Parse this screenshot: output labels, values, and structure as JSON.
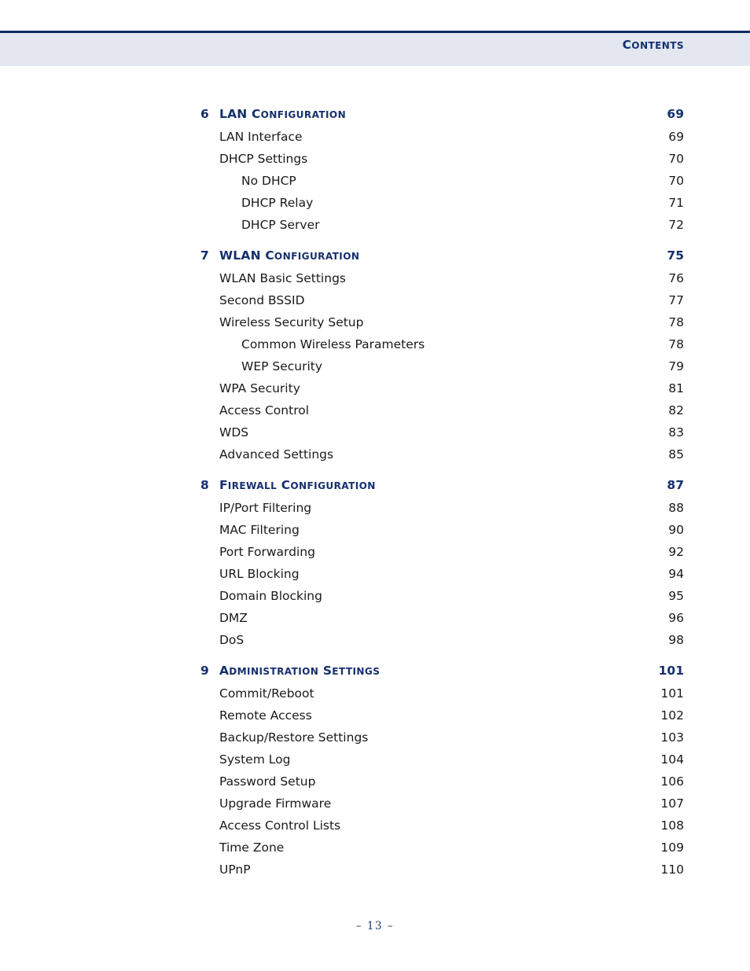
{
  "header": {
    "title_lead": "C",
    "title_rest": "ONTENTS",
    "rule_color": "#0b2a63",
    "band_color": "#e4e7f0",
    "accent_color": "#16306e"
  },
  "footer": {
    "page_marker": "–  13  –"
  },
  "toc": {
    "sections": [
      {
        "number": "6",
        "title_lead": "LAN C",
        "title_rest": "ONFIGURATION",
        "page": "69",
        "entries": [
          {
            "level": 1,
            "label": "LAN Interface",
            "page": "69"
          },
          {
            "level": 1,
            "label": "DHCP Settings",
            "page": "70"
          },
          {
            "level": 2,
            "label": "No DHCP",
            "page": "70"
          },
          {
            "level": 2,
            "label": "DHCP Relay",
            "page": "71"
          },
          {
            "level": 2,
            "label": "DHCP Server",
            "page": "72"
          }
        ]
      },
      {
        "number": "7",
        "title_lead": "WLAN C",
        "title_rest": "ONFIGURATION",
        "page": "75",
        "entries": [
          {
            "level": 1,
            "label": "WLAN Basic Settings",
            "page": "76"
          },
          {
            "level": 1,
            "label": "Second BSSID",
            "page": "77"
          },
          {
            "level": 1,
            "label": "Wireless Security Setup",
            "page": "78"
          },
          {
            "level": 2,
            "label": "Common Wireless Parameters",
            "page": "78"
          },
          {
            "level": 2,
            "label": "WEP Security",
            "page": "79"
          },
          {
            "level": 1,
            "label": "WPA Security",
            "page": "81"
          },
          {
            "level": 1,
            "label": "Access Control",
            "page": "82"
          },
          {
            "level": 1,
            "label": "WDS",
            "page": "83"
          },
          {
            "level": 1,
            "label": "Advanced Settings",
            "page": "85"
          }
        ]
      },
      {
        "number": "8",
        "title_lead": "F",
        "title_mid": "IREWALL",
        "title_lead2": " C",
        "title_rest": "ONFIGURATION",
        "page": "87",
        "entries": [
          {
            "level": 1,
            "label": "IP/Port Filtering",
            "page": "88"
          },
          {
            "level": 1,
            "label": "MAC Filtering",
            "page": "90"
          },
          {
            "level": 1,
            "label": "Port Forwarding",
            "page": "92"
          },
          {
            "level": 1,
            "label": "URL Blocking",
            "page": "94"
          },
          {
            "level": 1,
            "label": "Domain Blocking",
            "page": "95"
          },
          {
            "level": 1,
            "label": "DMZ",
            "page": "96"
          },
          {
            "level": 1,
            "label": "DoS",
            "page": "98"
          }
        ]
      },
      {
        "number": "9",
        "title_lead": "A",
        "title_mid": "DMINISTRATION",
        "title_lead2": " S",
        "title_rest": "ETTINGS",
        "page": "101",
        "entries": [
          {
            "level": 1,
            "label": "Commit/Reboot",
            "page": "101"
          },
          {
            "level": 1,
            "label": "Remote Access",
            "page": "102"
          },
          {
            "level": 1,
            "label": "Backup/Restore Settings",
            "page": "103"
          },
          {
            "level": 1,
            "label": "System Log",
            "page": "104"
          },
          {
            "level": 1,
            "label": "Password Setup",
            "page": "106"
          },
          {
            "level": 1,
            "label": "Upgrade Firmware",
            "page": "107"
          },
          {
            "level": 1,
            "label": "Access Control Lists",
            "page": "108"
          },
          {
            "level": 1,
            "label": "Time Zone",
            "page": "109"
          },
          {
            "level": 1,
            "label": "UPnP",
            "page": "110"
          }
        ]
      }
    ]
  }
}
